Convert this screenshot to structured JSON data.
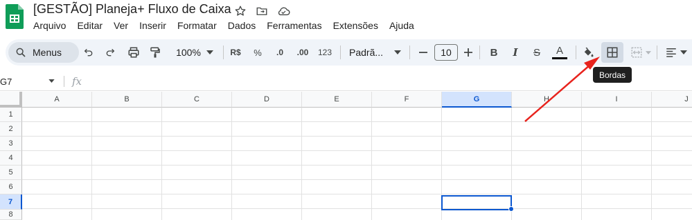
{
  "app": {
    "doc_title": "[GESTÃO] Planeja+ Fluxo de Caixa",
    "brand_color": "#0f9d58",
    "accent_color": "#0b57d0"
  },
  "menu": [
    "Arquivo",
    "Editar",
    "Ver",
    "Inserir",
    "Formatar",
    "Dados",
    "Ferramentas",
    "Extensões",
    "Ajuda"
  ],
  "toolbar": {
    "search_label": "Menus",
    "zoom": "100%",
    "currency": "R$",
    "percent": "%",
    "dec_decrease": ".0",
    "dec_increase": ".00",
    "number_format": "123",
    "font": "Padrã...",
    "font_size": "10",
    "bold": "B",
    "italic": "I",
    "strike": "S",
    "text_color": "A",
    "text_color_swatch": "#000000"
  },
  "tooltip": "Bordas",
  "formula_bar": {
    "name_box": "G7",
    "fx": "fx"
  },
  "grid": {
    "columns": [
      "A",
      "B",
      "C",
      "D",
      "E",
      "F",
      "G",
      "H",
      "I",
      "J"
    ],
    "rows": [
      "1",
      "2",
      "3",
      "4",
      "5",
      "6",
      "7",
      "8"
    ],
    "active_column": "G",
    "active_row": "7"
  },
  "annotation": {
    "arrow_color": "#e8231d"
  }
}
